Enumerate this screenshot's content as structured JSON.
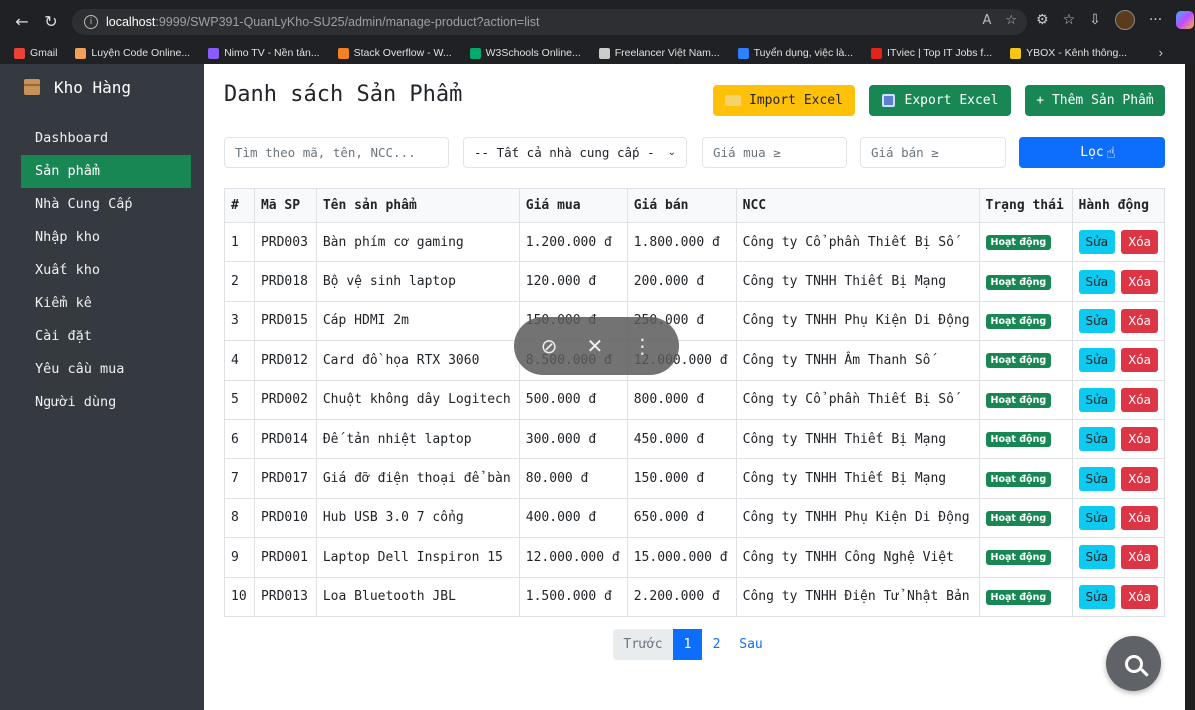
{
  "browser": {
    "url_host": "localhost",
    "url_path": ":9999/SWP391-QuanLyKho-SU25/admin/manage-product?action=list",
    "bookmarks": [
      {
        "label": "Gmail",
        "color": "#ea4335"
      },
      {
        "label": "Luyện Code Online...",
        "color": "#f0a05a"
      },
      {
        "label": "Nimo TV - Nền tản...",
        "color": "#8a5cff"
      },
      {
        "label": "Stack Overflow - W...",
        "color": "#f48024"
      },
      {
        "label": "W3Schools Online...",
        "color": "#04aa6d"
      },
      {
        "label": "Freelancer Việt Nam...",
        "color": "#cccccc"
      },
      {
        "label": "Tuyển dụng, việc là...",
        "color": "#2f7fff"
      },
      {
        "label": "ITviec | Top IT Jobs f...",
        "color": "#e1251b"
      },
      {
        "label": "YBOX - Kênh thông...",
        "color": "#f5c518"
      }
    ]
  },
  "sidebar": {
    "brand": "Kho Hàng",
    "items": [
      {
        "label": "Dashboard"
      },
      {
        "label": "Sản phẩm"
      },
      {
        "label": "Nhà Cung Cấp"
      },
      {
        "label": "Nhập kho"
      },
      {
        "label": "Xuất kho"
      },
      {
        "label": "Kiểm kê"
      },
      {
        "label": "Cài đặt"
      },
      {
        "label": "Yêu cầu mua"
      },
      {
        "label": "Người dùng"
      }
    ]
  },
  "main": {
    "title": "Danh sách Sản Phẩm",
    "import_label": "Import Excel",
    "export_label": "Export Excel",
    "add_label": "+ Thêm Sản Phẩm",
    "filters": {
      "search_placeholder": "Tìm theo mã, tên, NCC...",
      "ncc_selected": "-- Tất cả nhà cung cấp -",
      "buy_placeholder": "Giá mua ≥",
      "sell_placeholder": "Giá bán ≥",
      "filter_label": "Lọc"
    },
    "table": {
      "headers": [
        "#",
        "Mã SP",
        "Tên sản phẩm",
        "Giá mua",
        "Giá bán",
        "NCC",
        "Trạng thái",
        "Hành động"
      ],
      "rows": [
        {
          "no": "1",
          "code": "PRD003",
          "name": "Bàn phím cơ gaming",
          "buy": "1.200.000 đ",
          "sell": "1.800.000 đ",
          "ncc": "Công ty Cổ phần Thiết Bị Số",
          "status": "Hoạt động"
        },
        {
          "no": "2",
          "code": "PRD018",
          "name": "Bộ vệ sinh laptop",
          "buy": "120.000 đ",
          "sell": "200.000 đ",
          "ncc": "Công ty TNHH Thiết Bị Mạng",
          "status": "Hoạt động"
        },
        {
          "no": "3",
          "code": "PRD015",
          "name": "Cáp HDMI 2m",
          "buy": "150.000 đ",
          "sell": "250.000 đ",
          "ncc": "Công ty TNHH Phụ Kiện Di Động",
          "status": "Hoạt động"
        },
        {
          "no": "4",
          "code": "PRD012",
          "name": "Card đồ họa RTX 3060",
          "buy": "8.500.000 đ",
          "sell": "12.000.000 đ",
          "ncc": "Công ty TNHH Âm Thanh Số",
          "status": "Hoạt động"
        },
        {
          "no": "5",
          "code": "PRD002",
          "name": "Chuột không dây Logitech",
          "buy": "500.000 đ",
          "sell": "800.000 đ",
          "ncc": "Công ty Cổ phần Thiết Bị Số",
          "status": "Hoạt động"
        },
        {
          "no": "6",
          "code": "PRD014",
          "name": "Đế tản nhiệt laptop",
          "buy": "300.000 đ",
          "sell": "450.000 đ",
          "ncc": "Công ty TNHH Thiết Bị Mạng",
          "status": "Hoạt động"
        },
        {
          "no": "7",
          "code": "PRD017",
          "name": "Giá đỡ điện thoại để bàn",
          "buy": "80.000 đ",
          "sell": "150.000 đ",
          "ncc": "Công ty TNHH Thiết Bị Mạng",
          "status": "Hoạt động"
        },
        {
          "no": "8",
          "code": "PRD010",
          "name": "Hub USB 3.0 7 cổng",
          "buy": "400.000 đ",
          "sell": "650.000 đ",
          "ncc": "Công ty TNHH Phụ Kiện Di Động",
          "status": "Hoạt động"
        },
        {
          "no": "9",
          "code": "PRD001",
          "name": "Laptop Dell Inspiron 15",
          "buy": "12.000.000 đ",
          "sell": "15.000.000 đ",
          "ncc": "Công ty TNHH Công Nghệ Việt",
          "status": "Hoạt động"
        },
        {
          "no": "10",
          "code": "PRD013",
          "name": "Loa Bluetooth JBL",
          "buy": "1.500.000 đ",
          "sell": "2.200.000 đ",
          "ncc": "Công ty TNHH Điện Tử Nhật Bản",
          "status": "Hoạt động"
        }
      ],
      "edit_label": "Sửa",
      "delete_label": "Xóa"
    },
    "pagination": {
      "prev": "Trước",
      "pages": [
        "1",
        "2"
      ],
      "next": "Sau",
      "current": "1"
    }
  }
}
